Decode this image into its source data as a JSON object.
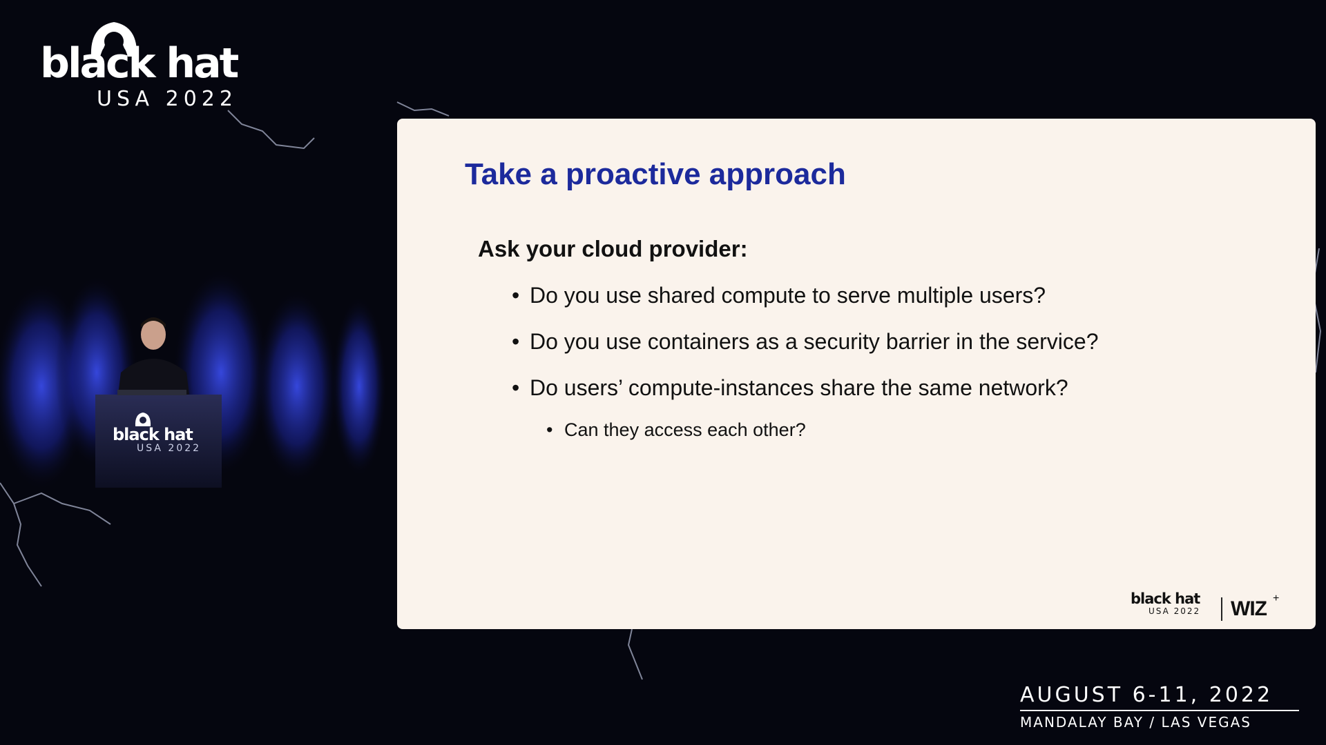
{
  "branding": {
    "event_title": "black hat",
    "event_subtitle": "USA 2022",
    "dates": "AUGUST 6-11, 2022",
    "venue": "MANDALAY BAY / LAS VEGAS"
  },
  "podium": {
    "title": "black hat",
    "subtitle": "USA 2022"
  },
  "slide": {
    "title": "Take a proactive approach",
    "heading": "Ask your cloud provider:",
    "bullets": [
      "Do you use shared compute to serve multiple users?",
      "Do you use containers as a security barrier in the service?",
      "Do users’ compute-instances share the same network?"
    ],
    "sub_bullets": [
      "Can they access each other?"
    ],
    "bullet_glyph": "•",
    "footer": {
      "bh_title": "black hat",
      "bh_subtitle": "USA 2022",
      "partner": "WIZ",
      "partner_mark": "+"
    }
  },
  "colors": {
    "background": "#05060f",
    "slide_background": "#faf3ec",
    "title": "#1c2a9c",
    "stage_glow": "#2b3bd6"
  },
  "icons": [
    "blackhat-logo-icon",
    "speaker-figure",
    "lightning-icon"
  ]
}
